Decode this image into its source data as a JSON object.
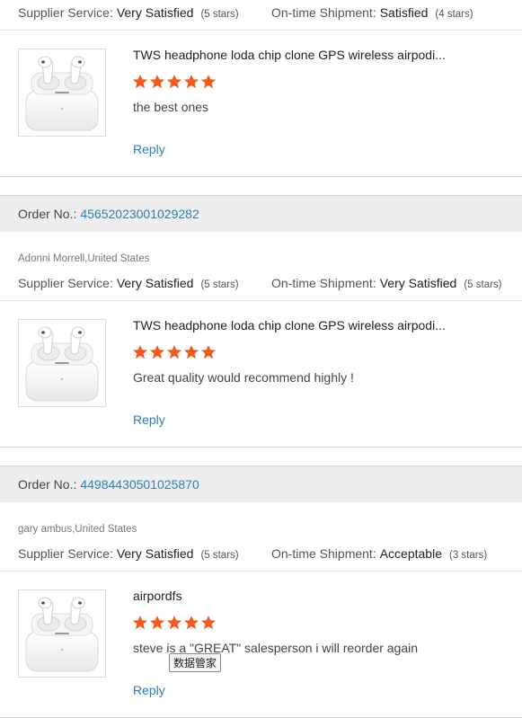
{
  "labels": {
    "supplier_service": "Supplier Service:",
    "ontime_shipment": "On-time Shipment:",
    "order_no": "Order No.:",
    "reply": "Reply"
  },
  "colors": {
    "star": "#f25a1d",
    "link": "#2b7fb8",
    "order_bar": "#eeeeee"
  },
  "reviews": [
    {
      "supplier_value": "Very Satisfied",
      "supplier_stars": "(5 stars)",
      "shipment_value": "Satisfied",
      "shipment_stars": "(4 stars)",
      "product_title": "TWS headphone loda chip clone GPS wireless airpodi...",
      "rating": 5,
      "comment": "the best ones"
    },
    {
      "order_number": "45652023001029282",
      "buyer": "Adonni Morrell,United States",
      "supplier_value": "Very Satisfied",
      "supplier_stars": "(5 stars)",
      "shipment_value": "Very Satisfied",
      "shipment_stars": "(5 stars)",
      "product_title": "TWS headphone loda chip clone GPS wireless airpodi...",
      "rating": 5,
      "comment": "Great quality would recommend highly !"
    },
    {
      "order_number": "44984430501025870",
      "buyer": "gary ambus,United States",
      "supplier_value": "Very Satisfied",
      "supplier_stars": "(5 stars)",
      "shipment_value": "Acceptable",
      "shipment_stars": "(3 stars)",
      "product_title": "airpordfs",
      "rating": 5,
      "comment": "steve is a \"GREAT\" salesperson i will reorder again"
    }
  ],
  "tooltip": "数据管家"
}
